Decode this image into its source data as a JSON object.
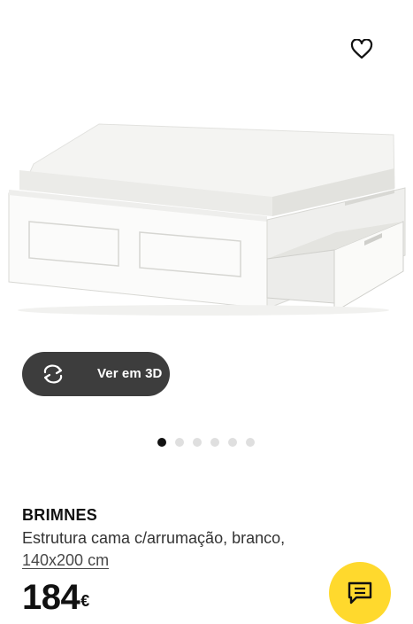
{
  "gallery": {
    "favorite_icon": "heart-icon",
    "view_3d_icon": "rotate-arrows-icon",
    "view_3d_label": "Ver em 3D",
    "slides_total": 6,
    "active_slide": 1
  },
  "product": {
    "name": "BRIMNES",
    "description": "Estrutura cama c/arrumação, branco,",
    "size": "140x200 cm",
    "price": "184",
    "currency": "€"
  },
  "chat": {
    "icon": "chat-bubble-icon",
    "color": "#ffd92d"
  }
}
